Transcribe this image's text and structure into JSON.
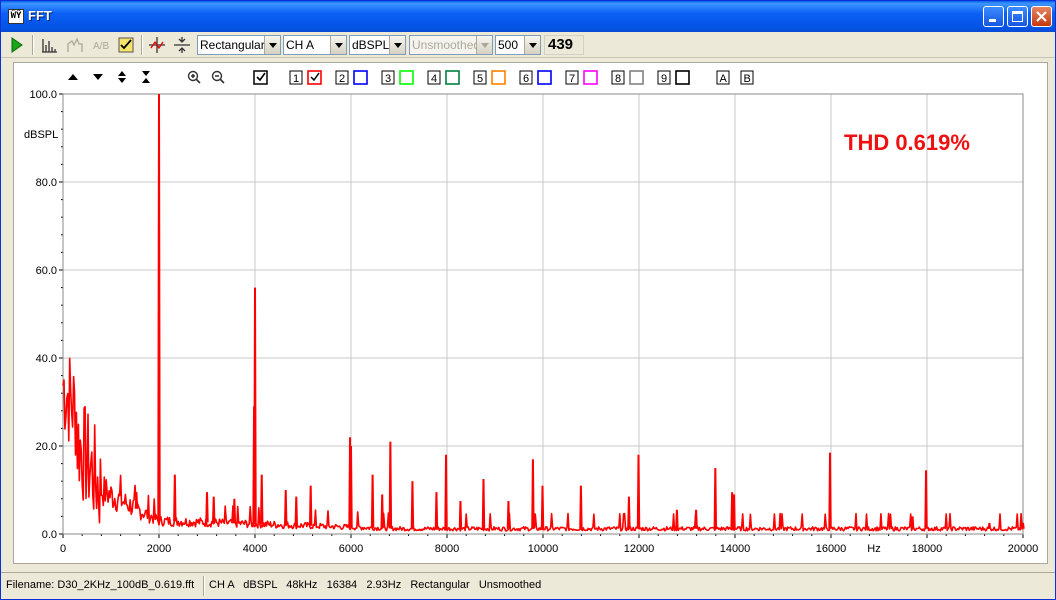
{
  "window": {
    "title": "FFT",
    "app_icon_text": "ŴŶ",
    "buttons": [
      "minimize",
      "maximize",
      "close"
    ]
  },
  "toolbar": {
    "window_function": "Rectangular",
    "channel": "CH A",
    "units": "dBSPL",
    "smoothing": "Unsmoothed",
    "range": "500",
    "count": "439",
    "icons": [
      "play-icon",
      "spectrum-icon",
      "peak-hold-icon",
      "ab-compare-icon",
      "checklist-icon",
      "crosshair-icon",
      "zoom-fit-icon"
    ]
  },
  "plot_controls": {
    "icons": [
      "arrow-up-icon",
      "arrow-down-icon",
      "expand-vertical-icon",
      "collapse-vertical-icon",
      "zoom-in-icon",
      "zoom-out-icon"
    ],
    "main_check": true,
    "traces": [
      {
        "num": "1",
        "color": "#ff0000",
        "checked": true
      },
      {
        "num": "2",
        "color": "#0000ff",
        "checked": false
      },
      {
        "num": "3",
        "color": "#00ff00",
        "checked": false
      },
      {
        "num": "4",
        "color": "#008040",
        "checked": false
      },
      {
        "num": "5",
        "color": "#ff8000",
        "checked": false
      },
      {
        "num": "6",
        "color": "#0000ff",
        "checked": false
      },
      {
        "num": "7",
        "color": "#ff00ff",
        "checked": false
      },
      {
        "num": "8",
        "color": "#808080",
        "checked": false
      },
      {
        "num": "9",
        "color": "#000000",
        "checked": false
      }
    ],
    "markers": [
      "A",
      "B"
    ]
  },
  "chart_data": {
    "type": "line",
    "ylabel": "dBSPL",
    "xlabel": "Hz",
    "annotation": "THD 0.619%",
    "xlim": [
      0,
      20000
    ],
    "ylim": [
      0,
      100
    ],
    "x_ticks": [
      "0",
      "2000",
      "4000",
      "6000",
      "8000",
      "10000",
      "12000",
      "14000",
      "16000",
      "18000",
      "20000"
    ],
    "y_ticks": [
      "0.0",
      "20.0",
      "40.0",
      "60.0",
      "80.0",
      "100.0"
    ],
    "grid": true,
    "series": [
      {
        "color": "#ff0000",
        "peaks": [
          {
            "x": 2000,
            "y": 100
          },
          {
            "x": 3980,
            "y": 29
          },
          {
            "x": 4000,
            "y": 56
          },
          {
            "x": 4140,
            "y": 13.5
          },
          {
            "x": 2330,
            "y": 13.5
          },
          {
            "x": 3000,
            "y": 9.5
          },
          {
            "x": 3140,
            "y": 8.5
          },
          {
            "x": 3570,
            "y": 8
          },
          {
            "x": 1530,
            "y": 9.5
          },
          {
            "x": 4640,
            "y": 10
          },
          {
            "x": 4860,
            "y": 8.5
          },
          {
            "x": 5160,
            "y": 11
          },
          {
            "x": 5980,
            "y": 22
          },
          {
            "x": 6000,
            "y": 20
          },
          {
            "x": 6450,
            "y": 13.5
          },
          {
            "x": 6650,
            "y": 9
          },
          {
            "x": 6820,
            "y": 21
          },
          {
            "x": 7280,
            "y": 12
          },
          {
            "x": 7780,
            "y": 9.5
          },
          {
            "x": 7980,
            "y": 18
          },
          {
            "x": 8280,
            "y": 7.5
          },
          {
            "x": 8760,
            "y": 12.5
          },
          {
            "x": 9280,
            "y": 7.5
          },
          {
            "x": 9790,
            "y": 17
          },
          {
            "x": 9990,
            "y": 11
          },
          {
            "x": 10790,
            "y": 11
          },
          {
            "x": 11790,
            "y": 8.5
          },
          {
            "x": 11990,
            "y": 18
          },
          {
            "x": 12790,
            "y": 5.5
          },
          {
            "x": 13190,
            "y": 5.5
          },
          {
            "x": 13590,
            "y": 15
          },
          {
            "x": 13940,
            "y": 9.5
          },
          {
            "x": 13980,
            "y": 9
          },
          {
            "x": 15980,
            "y": 18.5
          },
          {
            "x": 17980,
            "y": 14.5
          },
          {
            "x": 17700,
            "y": 4
          },
          {
            "x": 19300,
            "y": 2.5
          },
          {
            "x": 20000,
            "y": 2.5
          }
        ]
      }
    ]
  },
  "statusbar": {
    "filename": "Filename: D30_2KHz_100dB_0.619.fft",
    "info": "CH A   dBSPL   48kHz   16384   2.93Hz   Rectangular   Unsmoothed"
  }
}
